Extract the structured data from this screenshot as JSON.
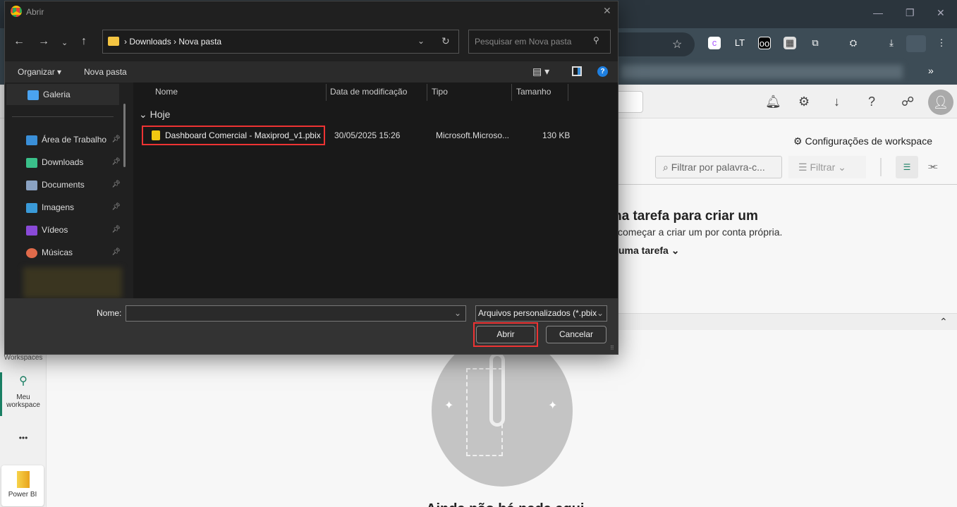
{
  "dialog": {
    "title": "Abrir",
    "breadcrumb": [
      "Downloads",
      "Nova pasta"
    ],
    "search_placeholder": "Pesquisar em Nova pasta",
    "organize_label": "Organizar",
    "new_folder_label": "Nova pasta",
    "nav_items": [
      {
        "label": "Galeria",
        "icon": "gallery-icon",
        "color": "#4aa3f0"
      },
      {
        "label": "Área de Trabalho",
        "icon": "desktop-icon",
        "color": "#3a8fd8"
      },
      {
        "label": "Downloads",
        "icon": "download-icon",
        "color": "#3ac08a"
      },
      {
        "label": "Documents",
        "icon": "document-icon",
        "color": "#8aa2c2"
      },
      {
        "label": "Imagens",
        "icon": "pictures-icon",
        "color": "#3a9ad8"
      },
      {
        "label": "Vídeos",
        "icon": "videos-icon",
        "color": "#8a4ad8"
      },
      {
        "label": "Músicas",
        "icon": "music-icon",
        "color": "#e06a4a"
      }
    ],
    "columns": [
      "Nome",
      "Data de modificação",
      "Tipo",
      "Tamanho"
    ],
    "group": "Hoje",
    "files": [
      {
        "name": "Dashboard Comercial - Maxiprod_v1.pbix",
        "modified": "30/05/2025 15:26",
        "type": "Microsoft.Microso...",
        "size": "130 KB"
      }
    ],
    "filename_label": "Nome:",
    "filename_value": "",
    "filetype": "Arquivos personalizados (*.pbix",
    "open_label": "Abrir",
    "cancel_label": "Cancelar"
  },
  "app": {
    "workspace_settings": "Configurações de workspace",
    "filter_placeholder": "Filtrar por palavra-c...",
    "filter_label": "Filtrar",
    "heading": "na tarefa para criar um",
    "subtext": "começar a criar um por conta própria.",
    "task_label": "uma tarefa",
    "rail": {
      "workspaces": "Workspaces",
      "my_workspace": "Meu workspace",
      "more": "•••",
      "powerbi": "Power BI"
    },
    "empty_title": "Ainda não há nada aqui"
  }
}
